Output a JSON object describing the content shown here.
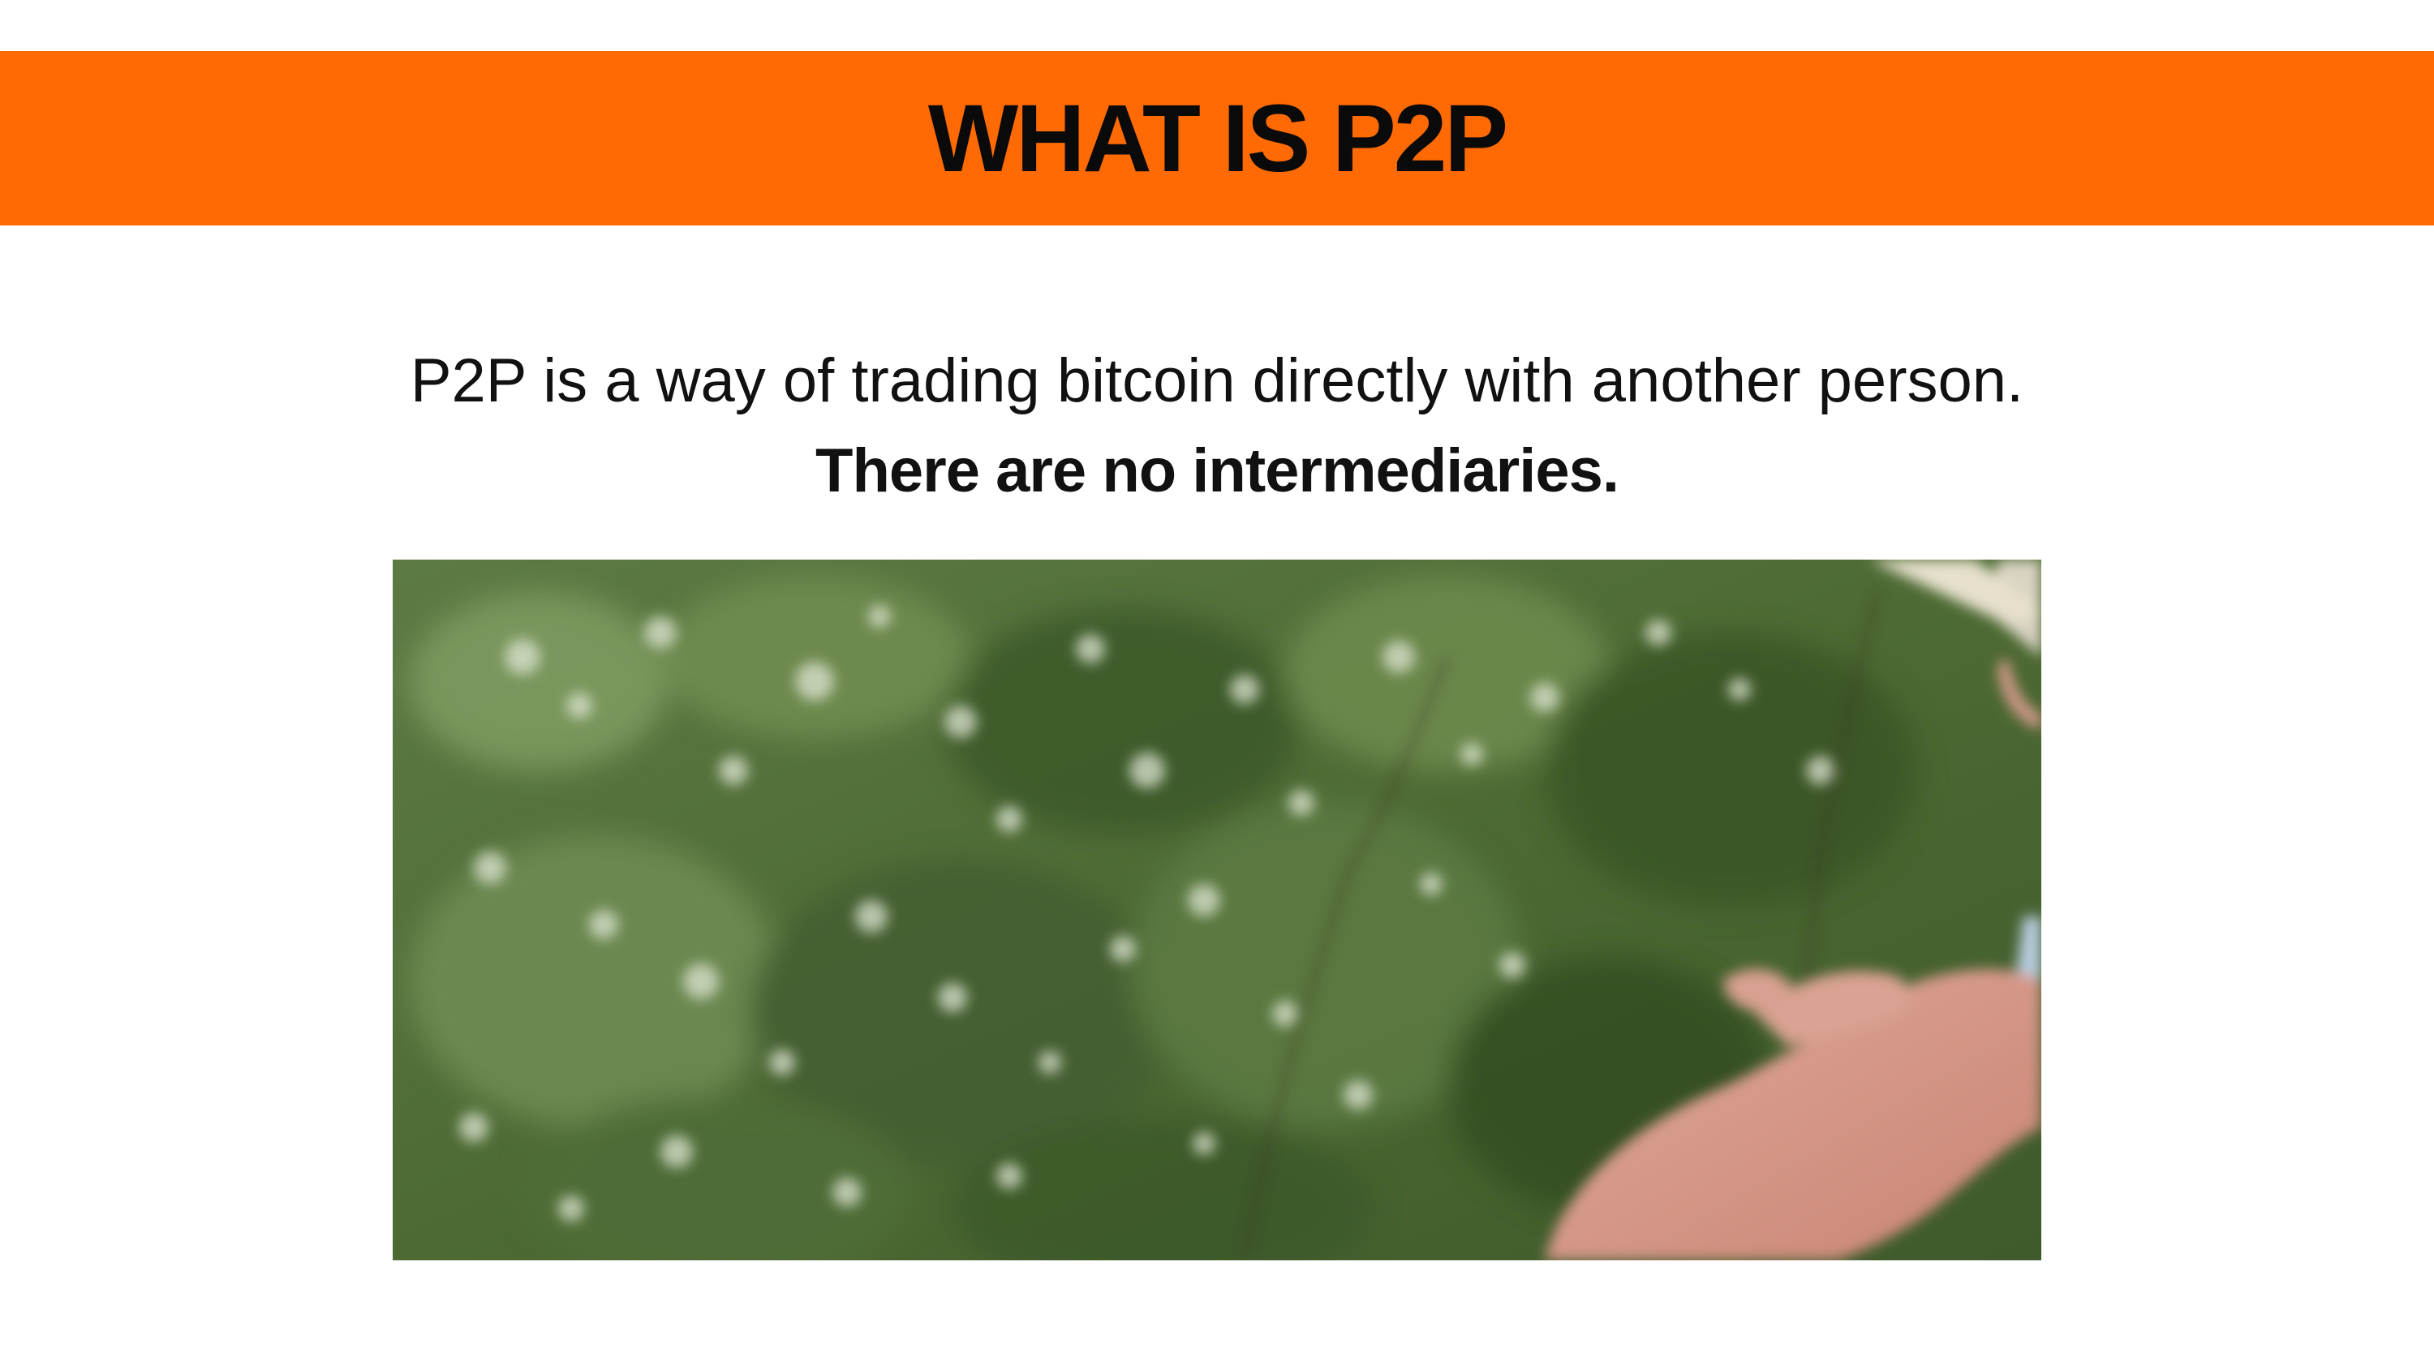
{
  "banner": {
    "title": "WHAT IS P2P",
    "background_color": "#ff6a05"
  },
  "intro": {
    "line1": "P2P is a way of trading bitcoin directly with another person.",
    "line2": "There are no intermediaries."
  },
  "media": {
    "image_description_icon": "photo-hands-exchanging-cash-icon"
  }
}
